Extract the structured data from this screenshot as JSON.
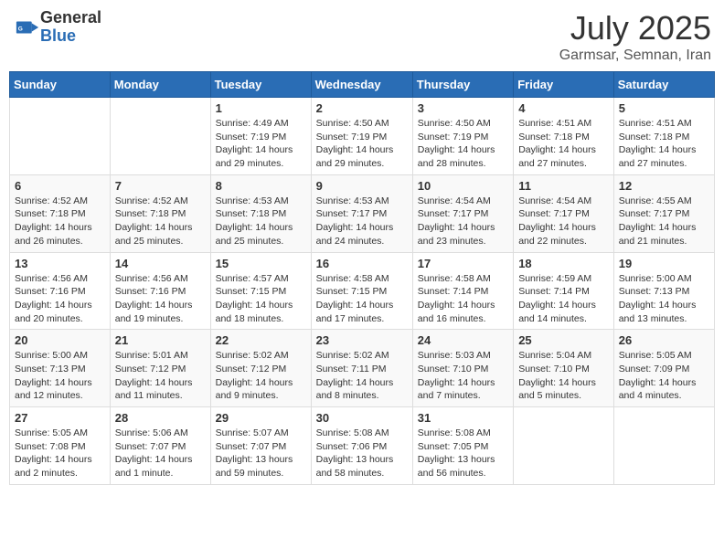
{
  "header": {
    "logo_general": "General",
    "logo_blue": "Blue",
    "month_year": "July 2025",
    "location": "Garmsar, Semnan, Iran"
  },
  "days_of_week": [
    "Sunday",
    "Monday",
    "Tuesday",
    "Wednesday",
    "Thursday",
    "Friday",
    "Saturday"
  ],
  "weeks": [
    [
      {
        "day": "",
        "sunrise": "",
        "sunset": "",
        "daylight": ""
      },
      {
        "day": "",
        "sunrise": "",
        "sunset": "",
        "daylight": ""
      },
      {
        "day": "1",
        "sunrise": "Sunrise: 4:49 AM",
        "sunset": "Sunset: 7:19 PM",
        "daylight": "Daylight: 14 hours and 29 minutes."
      },
      {
        "day": "2",
        "sunrise": "Sunrise: 4:50 AM",
        "sunset": "Sunset: 7:19 PM",
        "daylight": "Daylight: 14 hours and 29 minutes."
      },
      {
        "day": "3",
        "sunrise": "Sunrise: 4:50 AM",
        "sunset": "Sunset: 7:19 PM",
        "daylight": "Daylight: 14 hours and 28 minutes."
      },
      {
        "day": "4",
        "sunrise": "Sunrise: 4:51 AM",
        "sunset": "Sunset: 7:18 PM",
        "daylight": "Daylight: 14 hours and 27 minutes."
      },
      {
        "day": "5",
        "sunrise": "Sunrise: 4:51 AM",
        "sunset": "Sunset: 7:18 PM",
        "daylight": "Daylight: 14 hours and 27 minutes."
      }
    ],
    [
      {
        "day": "6",
        "sunrise": "Sunrise: 4:52 AM",
        "sunset": "Sunset: 7:18 PM",
        "daylight": "Daylight: 14 hours and 26 minutes."
      },
      {
        "day": "7",
        "sunrise": "Sunrise: 4:52 AM",
        "sunset": "Sunset: 7:18 PM",
        "daylight": "Daylight: 14 hours and 25 minutes."
      },
      {
        "day": "8",
        "sunrise": "Sunrise: 4:53 AM",
        "sunset": "Sunset: 7:18 PM",
        "daylight": "Daylight: 14 hours and 25 minutes."
      },
      {
        "day": "9",
        "sunrise": "Sunrise: 4:53 AM",
        "sunset": "Sunset: 7:17 PM",
        "daylight": "Daylight: 14 hours and 24 minutes."
      },
      {
        "day": "10",
        "sunrise": "Sunrise: 4:54 AM",
        "sunset": "Sunset: 7:17 PM",
        "daylight": "Daylight: 14 hours and 23 minutes."
      },
      {
        "day": "11",
        "sunrise": "Sunrise: 4:54 AM",
        "sunset": "Sunset: 7:17 PM",
        "daylight": "Daylight: 14 hours and 22 minutes."
      },
      {
        "day": "12",
        "sunrise": "Sunrise: 4:55 AM",
        "sunset": "Sunset: 7:17 PM",
        "daylight": "Daylight: 14 hours and 21 minutes."
      }
    ],
    [
      {
        "day": "13",
        "sunrise": "Sunrise: 4:56 AM",
        "sunset": "Sunset: 7:16 PM",
        "daylight": "Daylight: 14 hours and 20 minutes."
      },
      {
        "day": "14",
        "sunrise": "Sunrise: 4:56 AM",
        "sunset": "Sunset: 7:16 PM",
        "daylight": "Daylight: 14 hours and 19 minutes."
      },
      {
        "day": "15",
        "sunrise": "Sunrise: 4:57 AM",
        "sunset": "Sunset: 7:15 PM",
        "daylight": "Daylight: 14 hours and 18 minutes."
      },
      {
        "day": "16",
        "sunrise": "Sunrise: 4:58 AM",
        "sunset": "Sunset: 7:15 PM",
        "daylight": "Daylight: 14 hours and 17 minutes."
      },
      {
        "day": "17",
        "sunrise": "Sunrise: 4:58 AM",
        "sunset": "Sunset: 7:14 PM",
        "daylight": "Daylight: 14 hours and 16 minutes."
      },
      {
        "day": "18",
        "sunrise": "Sunrise: 4:59 AM",
        "sunset": "Sunset: 7:14 PM",
        "daylight": "Daylight: 14 hours and 14 minutes."
      },
      {
        "day": "19",
        "sunrise": "Sunrise: 5:00 AM",
        "sunset": "Sunset: 7:13 PM",
        "daylight": "Daylight: 14 hours and 13 minutes."
      }
    ],
    [
      {
        "day": "20",
        "sunrise": "Sunrise: 5:00 AM",
        "sunset": "Sunset: 7:13 PM",
        "daylight": "Daylight: 14 hours and 12 minutes."
      },
      {
        "day": "21",
        "sunrise": "Sunrise: 5:01 AM",
        "sunset": "Sunset: 7:12 PM",
        "daylight": "Daylight: 14 hours and 11 minutes."
      },
      {
        "day": "22",
        "sunrise": "Sunrise: 5:02 AM",
        "sunset": "Sunset: 7:12 PM",
        "daylight": "Daylight: 14 hours and 9 minutes."
      },
      {
        "day": "23",
        "sunrise": "Sunrise: 5:02 AM",
        "sunset": "Sunset: 7:11 PM",
        "daylight": "Daylight: 14 hours and 8 minutes."
      },
      {
        "day": "24",
        "sunrise": "Sunrise: 5:03 AM",
        "sunset": "Sunset: 7:10 PM",
        "daylight": "Daylight: 14 hours and 7 minutes."
      },
      {
        "day": "25",
        "sunrise": "Sunrise: 5:04 AM",
        "sunset": "Sunset: 7:10 PM",
        "daylight": "Daylight: 14 hours and 5 minutes."
      },
      {
        "day": "26",
        "sunrise": "Sunrise: 5:05 AM",
        "sunset": "Sunset: 7:09 PM",
        "daylight": "Daylight: 14 hours and 4 minutes."
      }
    ],
    [
      {
        "day": "27",
        "sunrise": "Sunrise: 5:05 AM",
        "sunset": "Sunset: 7:08 PM",
        "daylight": "Daylight: 14 hours and 2 minutes."
      },
      {
        "day": "28",
        "sunrise": "Sunrise: 5:06 AM",
        "sunset": "Sunset: 7:07 PM",
        "daylight": "Daylight: 14 hours and 1 minute."
      },
      {
        "day": "29",
        "sunrise": "Sunrise: 5:07 AM",
        "sunset": "Sunset: 7:07 PM",
        "daylight": "Daylight: 13 hours and 59 minutes."
      },
      {
        "day": "30",
        "sunrise": "Sunrise: 5:08 AM",
        "sunset": "Sunset: 7:06 PM",
        "daylight": "Daylight: 13 hours and 58 minutes."
      },
      {
        "day": "31",
        "sunrise": "Sunrise: 5:08 AM",
        "sunset": "Sunset: 7:05 PM",
        "daylight": "Daylight: 13 hours and 56 minutes."
      },
      {
        "day": "",
        "sunrise": "",
        "sunset": "",
        "daylight": ""
      },
      {
        "day": "",
        "sunrise": "",
        "sunset": "",
        "daylight": ""
      }
    ]
  ]
}
